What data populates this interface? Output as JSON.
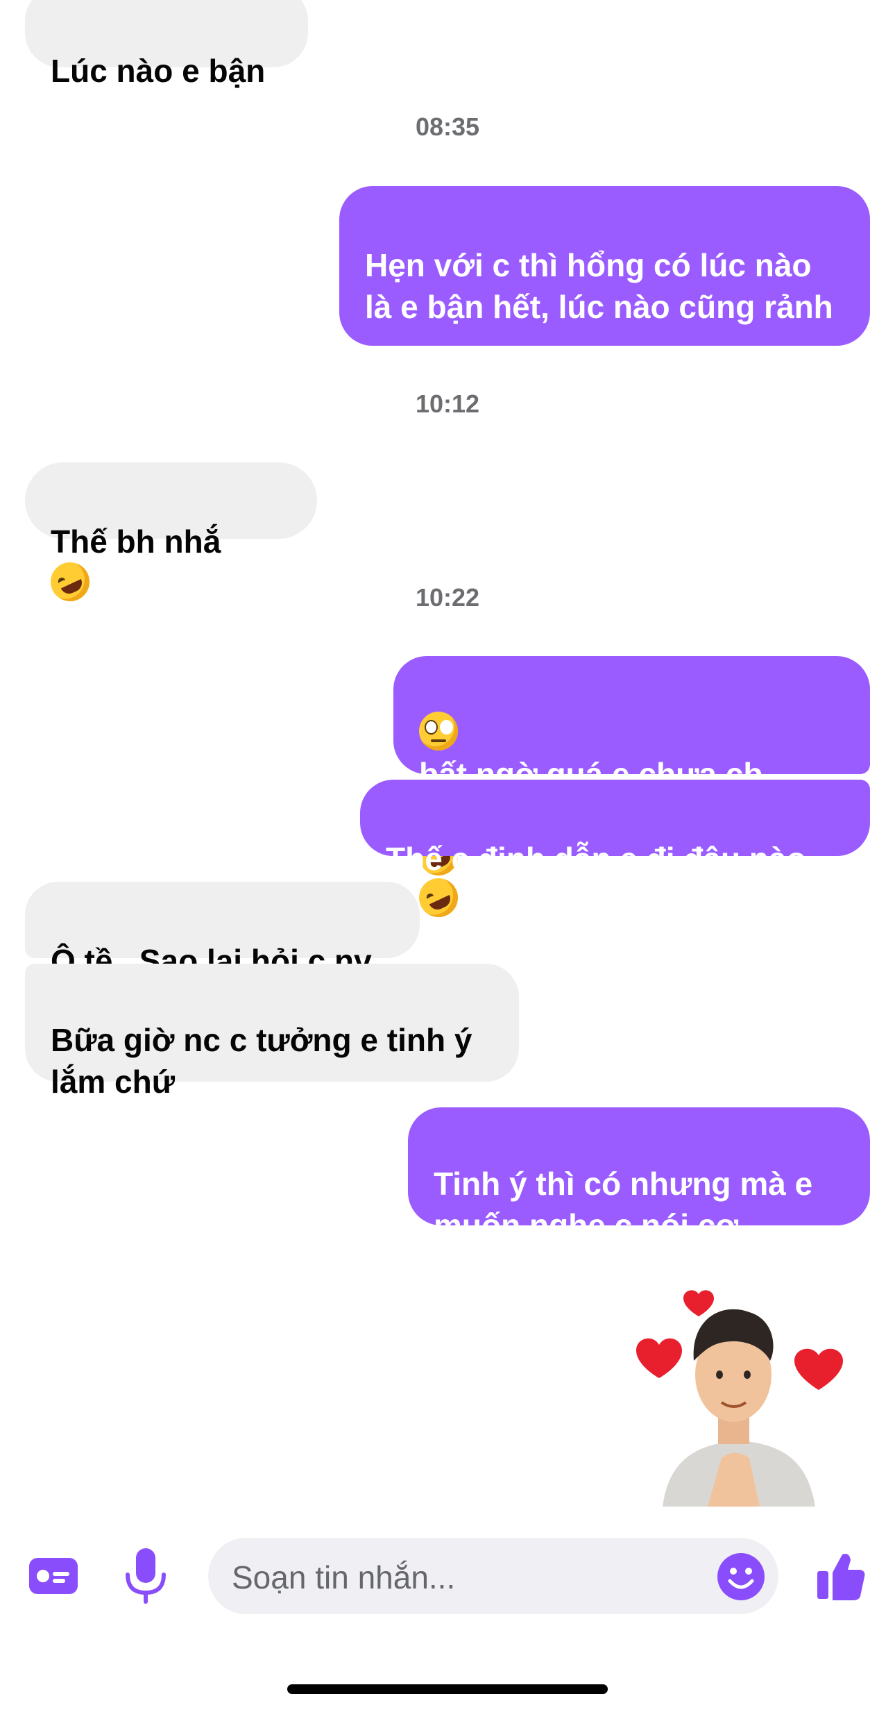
{
  "conversation": {
    "messages": [
      {
        "side": "in",
        "text": "Lúc nào e bận"
      },
      {
        "side": "out",
        "text": "Hẹn với c thì hổng có lúc nào là e bận hết, lúc nào cũng rảnh"
      },
      {
        "side": "in",
        "text": "Thế bh nhắ"
      },
      {
        "side": "out",
        "text": "bất ngờ quá e chưa cb được gì cả"
      },
      {
        "side": "out",
        "text": "Thế c định dẫn e đi đâu nào"
      },
      {
        "side": "in",
        "text": "Ô tề . Sao lại hỏi c nv"
      },
      {
        "side": "in",
        "text": "Bữa giờ nc c tưởng e tinh ý lắm chứ"
      },
      {
        "side": "out",
        "text": "Tinh ý thì có nhưng mà e muốn nghe c nói cơ"
      }
    ],
    "timestamps": [
      "08:35",
      "10:12",
      "10:22"
    ],
    "sticker": {
      "name": "avatar-heart-sticker",
      "side": "out"
    }
  },
  "composer": {
    "placeholder": "Soạn tin nhắn...",
    "icons": [
      "contact-card-icon",
      "microphone-icon",
      "emoji-icon",
      "thumbs-up-icon"
    ]
  },
  "colors": {
    "outgoing_bubble": "#9a5cff",
    "incoming_bubble": "#efeff0",
    "accent": "#8a4dfb",
    "timestamp": "#6b6d70"
  }
}
